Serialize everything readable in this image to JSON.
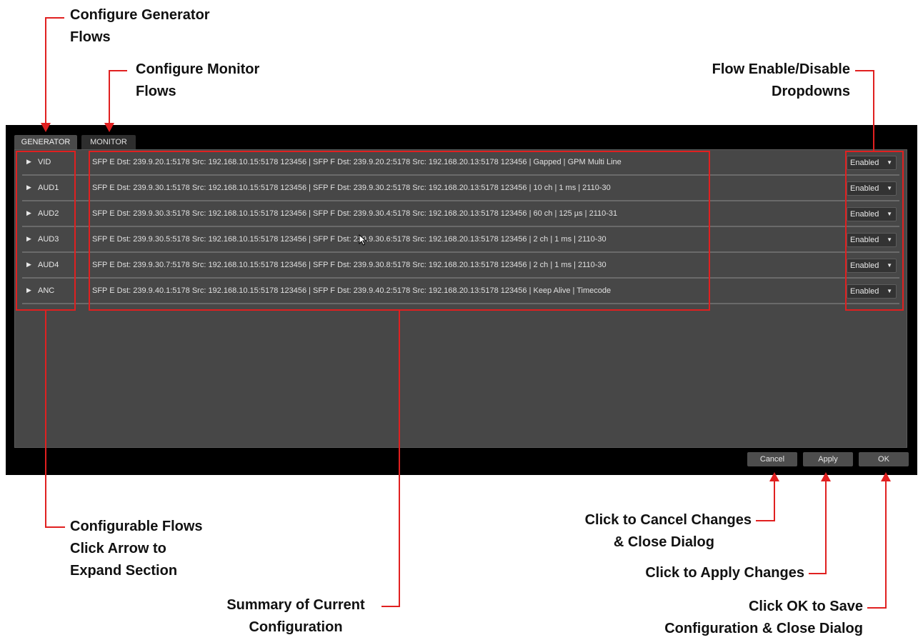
{
  "tabs": [
    {
      "label": "GENERATOR"
    },
    {
      "label": "MONITOR"
    }
  ],
  "flows": [
    {
      "name": "VID",
      "summary": "SFP E Dst: 239.9.20.1:5178 Src: 192.168.10.15:5178 123456 | SFP F Dst: 239.9.20.2:5178 Src: 192.168.20.13:5178 123456 | Gapped | GPM Multi Line",
      "status": "Enabled"
    },
    {
      "name": "AUD1",
      "summary": "SFP E Dst: 239.9.30.1:5178 Src: 192.168.10.15:5178 123456 | SFP F Dst: 239.9.30.2:5178 Src: 192.168.20.13:5178 123456 | 10 ch | 1 ms | 2110-30",
      "status": "Enabled"
    },
    {
      "name": "AUD2",
      "summary": "SFP E Dst: 239.9.30.3:5178 Src: 192.168.10.15:5178 123456 | SFP F Dst: 239.9.30.4:5178 Src: 192.168.20.13:5178 123456 | 60 ch | 125 µs | 2110-31",
      "status": "Enabled"
    },
    {
      "name": "AUD3",
      "summary": "SFP E Dst: 239.9.30.5:5178 Src: 192.168.10.15:5178 123456 | SFP F Dst: 239.9.30.6:5178 Src: 192.168.20.13:5178 123456 | 2 ch | 1 ms | 2110-30",
      "status": "Enabled"
    },
    {
      "name": "AUD4",
      "summary": "SFP E Dst: 239.9.30.7:5178 Src: 192.168.10.15:5178 123456 | SFP F Dst: 239.9.30.8:5178 Src: 192.168.20.13:5178 123456 | 2 ch | 1 ms | 2110-30",
      "status": "Enabled"
    },
    {
      "name": "ANC",
      "summary": "SFP E Dst: 239.9.40.1:5178 Src: 192.168.10.15:5178 123456 | SFP F Dst: 239.9.40.2:5178 Src: 192.168.20.13:5178 123456 | Keep Alive | Timecode",
      "status": "Enabled"
    }
  ],
  "buttons": {
    "cancel": "Cancel",
    "apply": "Apply",
    "ok": "OK"
  },
  "annotations": {
    "generator": [
      "Configure Generator",
      "Flows"
    ],
    "monitor": [
      "Configure Monitor",
      "Flows"
    ],
    "dropdowns": [
      "Flow Enable/Disable",
      "Dropdowns"
    ],
    "flows": [
      "Configurable Flows",
      "Click Arrow to",
      "Expand Section"
    ],
    "summary": [
      "Summary of Current",
      "Configuration"
    ],
    "cancel": [
      "Click to Cancel Changes",
      "& Close Dialog"
    ],
    "apply": [
      "Click to Apply Changes"
    ],
    "ok": [
      "Click OK to Save",
      "Configuration & Close Dialog"
    ]
  },
  "colors": {
    "annotation": "#e02020",
    "panel": "#474747",
    "dialog": "#000000"
  },
  "icons": {
    "expand": "triangle-right-icon",
    "dropdown": "caret-down-icon",
    "pointer": "mouse-cursor-icon"
  }
}
